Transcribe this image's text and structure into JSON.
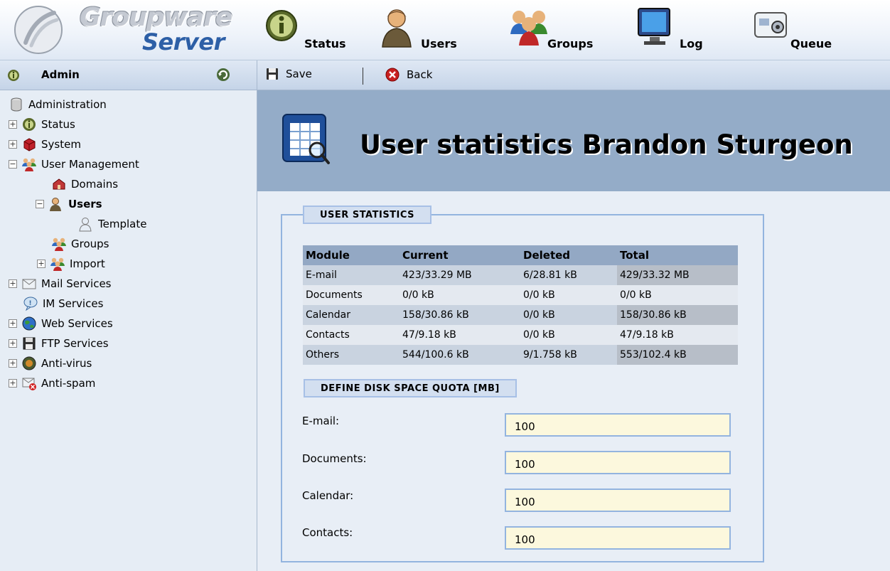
{
  "app": {
    "logo_line1": "Groupware",
    "logo_line2": "Server"
  },
  "main_nav": [
    {
      "label": "Status",
      "icon": "status-icon"
    },
    {
      "label": "Users",
      "icon": "user-icon"
    },
    {
      "label": "Groups",
      "icon": "groups-icon"
    },
    {
      "label": "Log",
      "icon": "monitor-icon"
    },
    {
      "label": "Queue",
      "icon": "queue-icon"
    }
  ],
  "sidebar": {
    "title": "Admin",
    "tree": [
      {
        "label": "Administration",
        "icon": "database-icon"
      },
      {
        "label": "Status",
        "icon": "status-icon"
      },
      {
        "label": "System",
        "icon": "system-icon"
      },
      {
        "label": "User Management",
        "icon": "groups-icon"
      },
      {
        "label": "Domains",
        "icon": "domains-icon"
      },
      {
        "label": "Users",
        "icon": "user-icon"
      },
      {
        "label": "Template",
        "icon": "template-user-icon"
      },
      {
        "label": "Groups",
        "icon": "groups-icon"
      },
      {
        "label": "Import",
        "icon": "groups-icon"
      },
      {
        "label": "Mail Services",
        "icon": "mail-icon"
      },
      {
        "label": "IM Services",
        "icon": "im-icon"
      },
      {
        "label": "Web Services",
        "icon": "globe-icon"
      },
      {
        "label": "FTP Services",
        "icon": "ftp-icon"
      },
      {
        "label": "Anti-virus",
        "icon": "antivirus-icon"
      },
      {
        "label": "Anti-spam",
        "icon": "antispam-icon"
      }
    ]
  },
  "toolbar": {
    "save_label": "Save",
    "back_label": "Back"
  },
  "page": {
    "title": "User statistics Brandon Sturgeon"
  },
  "stats": {
    "legend": "USER STATISTICS",
    "columns": [
      "Module",
      "Current",
      "Deleted",
      "Total"
    ],
    "rows": [
      [
        "E-mail",
        "423/33.29 MB",
        "6/28.81 kB",
        "429/33.32 MB"
      ],
      [
        "Documents",
        "0/0 kB",
        "0/0 kB",
        "0/0 kB"
      ],
      [
        "Calendar",
        "158/30.86 kB",
        "0/0 kB",
        "158/30.86 kB"
      ],
      [
        "Contacts",
        "47/9.18 kB",
        "0/0 kB",
        "47/9.18 kB"
      ],
      [
        "Others",
        "544/100.6 kB",
        "9/1.758 kB",
        "553/102.4 kB"
      ]
    ]
  },
  "quota": {
    "legend": "DEFINE DISK SPACE QUOTA [MB]",
    "fields": [
      {
        "label": "E-mail:",
        "value": "100"
      },
      {
        "label": "Documents:",
        "value": "100"
      },
      {
        "label": "Calendar:",
        "value": "100"
      },
      {
        "label": "Contacts:",
        "value": "100"
      }
    ]
  }
}
